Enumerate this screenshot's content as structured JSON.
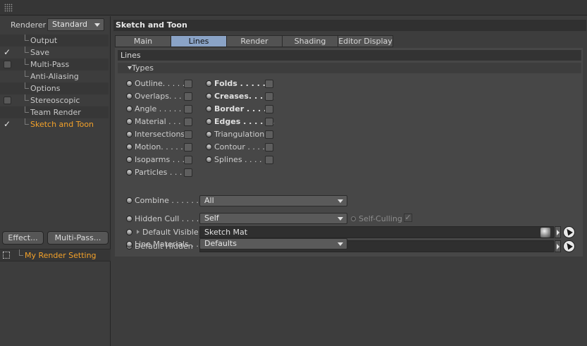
{
  "renderer": {
    "label": "Renderer",
    "value": "Standard"
  },
  "settings_list": [
    {
      "label": "Output",
      "checkbox": "none"
    },
    {
      "label": "Save",
      "checkbox": "checked"
    },
    {
      "label": "Multi-Pass",
      "checkbox": "unchecked"
    },
    {
      "label": "Anti-Aliasing",
      "checkbox": "none"
    },
    {
      "label": "Options",
      "checkbox": "none"
    },
    {
      "label": "Stereoscopic",
      "checkbox": "unchecked"
    },
    {
      "label": "Team Render",
      "checkbox": "none"
    },
    {
      "label": "Sketch and Toon",
      "checkbox": "checked",
      "active": true
    }
  ],
  "buttons": {
    "effect": "Effect...",
    "multipass": "Multi-Pass..."
  },
  "render_setting": {
    "label": "My Render Setting"
  },
  "panel": {
    "title": "Sketch and Toon",
    "tabs": [
      {
        "label": "Main",
        "active": false
      },
      {
        "label": "Lines",
        "active": true
      },
      {
        "label": "Render",
        "active": false
      },
      {
        "label": "Shading",
        "active": false
      },
      {
        "label": "Editor Display",
        "active": false
      }
    ],
    "section_title": "Lines",
    "group_title": "Types",
    "types_left": [
      "Outline. . . . .",
      "Overlaps. . . .",
      "Angle . . . . . .",
      "Material . . . .",
      "Intersections",
      "Motion. . . . . .",
      "Isoparms . . .",
      "Particles . . . ."
    ],
    "types_right": [
      "Folds . . . . . .",
      "Creases. . . . .",
      "Border . . . . .",
      "Edges . . . . . .",
      "Triangulation",
      "Contour . . . .",
      "Splines . . . . ."
    ],
    "combine": {
      "label": "Combine . . . . . .",
      "value": "All"
    },
    "hidden_cull": {
      "label": "Hidden Cull . . . .",
      "value": "Self"
    },
    "self_culling": {
      "label": "Self-Culling",
      "checked": true
    },
    "default_visible": {
      "label": "Default Visible",
      "value": "Sketch Mat"
    },
    "default_hidden": {
      "label": "Default Hidden",
      "value": ""
    },
    "line_materials": {
      "label": "Line Materials . .",
      "value": "Defaults"
    }
  },
  "colors": {
    "accent": "#f4a22a",
    "active_tab": "#8aa3c6",
    "bg": "#3d3d3d"
  }
}
